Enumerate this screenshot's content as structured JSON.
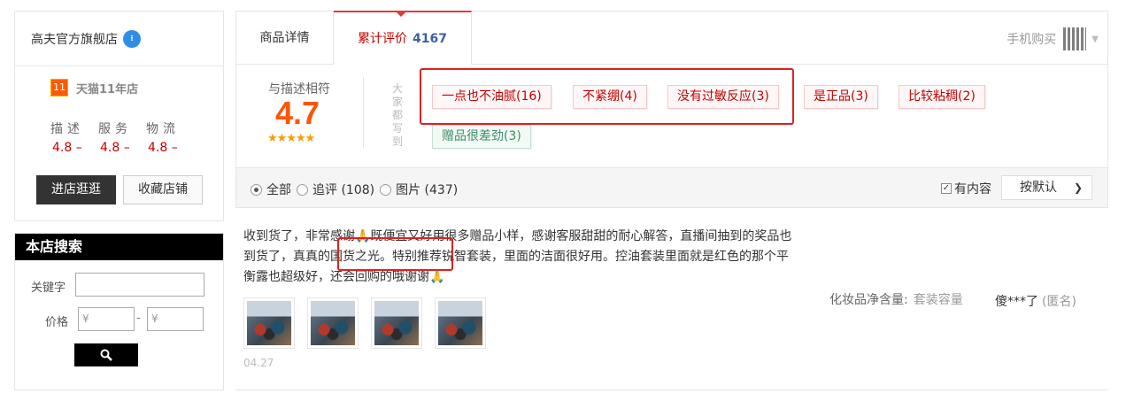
{
  "shop": {
    "name": "高夫官方旗舰店",
    "ww_glyph": "⁝",
    "tmall_badge": "11",
    "tmall_years": "天猫11年店",
    "dsr_labels": [
      "描述",
      "服务",
      "物流"
    ],
    "dsr_values": [
      "4.8 –",
      "4.8 –",
      "4.8 –"
    ],
    "enter_label": "进店逛逛",
    "fav_label": "收藏店铺"
  },
  "search": {
    "title": "本店搜索",
    "keyword_label": "关键字",
    "price_label": "价格",
    "price_min_placeholder": "¥",
    "price_max_placeholder": "¥",
    "dash": "-"
  },
  "tabs": {
    "detail": "商品详情",
    "review": "累计评价",
    "review_count": "4167",
    "mobile_buy": "手机购买"
  },
  "summary": {
    "score_label": "与描述相符",
    "score": "4.7",
    "stars": "★★★★★",
    "everyone_says": "大家都写到",
    "tags": [
      {
        "text": "一点也不油腻(16)",
        "type": "pos"
      },
      {
        "text": "不紧绷(4)",
        "type": "pos"
      },
      {
        "text": "没有过敏反应(3)",
        "type": "pos"
      },
      {
        "text": "是正品(3)",
        "type": "pos"
      },
      {
        "text": "比较粘稠(2)",
        "type": "pos"
      },
      {
        "text": "赠品很差劲(3)",
        "type": "neg"
      }
    ]
  },
  "filter": {
    "options": [
      "全部",
      "追评 (108)",
      "图片 (437)"
    ],
    "selected": "全部",
    "has_content": "有内容",
    "sort": "按默认"
  },
  "review": {
    "text": "收到货了，非常感谢🙏既便宜又好用很多赠品小样，感谢客服甜甜的耐心解答，直播间抽到的奖品也到货了，真真的国货之光。特别推荐锐智套装，里面的洁面很好用。控油套装里面就是红色的那个平衡露也超级好，还会回购的哦谢谢🙏",
    "spec_label": "化妆品净含量:",
    "spec_value": "套装容量",
    "author": "傻***了",
    "anonymous": "(匿名)",
    "date": "04.27"
  },
  "colors": {
    "accent_red": "#c40000",
    "highlight_red": "#e02020",
    "score_orange": "#ff5500",
    "tmall_orange": "#ff5a00"
  }
}
